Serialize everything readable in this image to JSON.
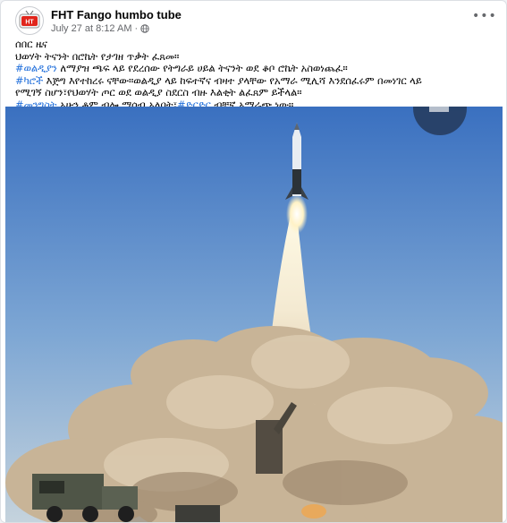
{
  "post": {
    "page_name": "FHT Fango humbo tube",
    "timestamp": "July 27 at 8:12 AM",
    "separator": "·",
    "avatar_text": "HT",
    "more_icon": "more-horizontal-icon",
    "privacy_icon": "globe-icon"
  },
  "body": {
    "line1": "ሰበር ዜና",
    "line2": "ህወሃት ትናንት በሮኬት የታገዘ ጥቃት ፈጸመ።",
    "line3_tag": "#ወልዲያን",
    "line3_text": " ለማያዝ ጫፍ ላይ የደረሰው የትግራይ ሀይል ትናንት ወደ ቆቦ ሮኬት አስወነጨፈ።",
    "line4_tag": "#ካሮች",
    "line4_text": " እጅግ እየተከረሩ ናቸው።ወልዲያ ላይ ከፍተኛና ብዛተ ያላቸው የአማራ ሚሊሻ እንደሰፈሩም በመነገር ላይ",
    "line5": "የሚገኝ ስሆን፣የህወሃት ጦር ወደ ወልዲያ ስደርስ ብዙ እልቂት ልፈጸም ይችላል።",
    "line6_tag1": "#መንግስት",
    "line6_text1": " አሁን ቆም ብሎ ማሰብ አለበት፣",
    "line6_tag2": "#ድርድር",
    "line6_text2": " ብቸኛ አማራጭ ነው።"
  },
  "media": {
    "icon": "rocket-launch-photo",
    "colors": {
      "sky_top": "#3f76c4",
      "sky_bottom": "#b9cde0",
      "smoke": "#c9b49a",
      "flame": "#fff6d8"
    }
  },
  "colors": {
    "hashtag": "#216fdb",
    "text": "#050505",
    "secondary": "#65676b"
  }
}
